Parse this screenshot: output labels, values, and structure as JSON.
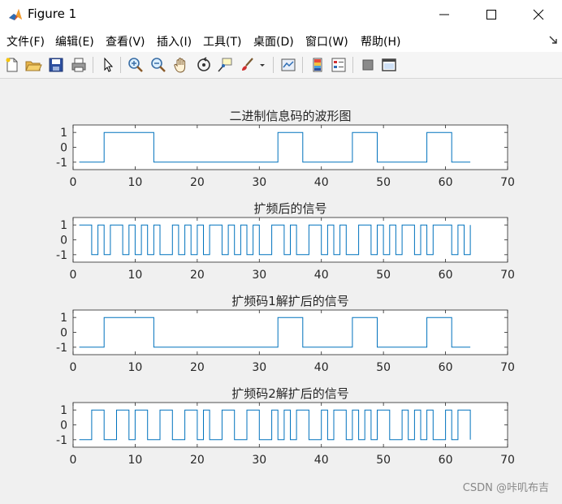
{
  "window": {
    "title": "Figure 1",
    "minimize_label": "–",
    "maximize_label": "□",
    "close_label": "✕"
  },
  "menu": [
    "文件(F)",
    "编辑(E)",
    "查看(V)",
    "插入(I)",
    "工具(T)",
    "桌面(D)",
    "窗口(W)",
    "帮助(H)"
  ],
  "toolbar": {
    "buttons": [
      "new-figure-icon",
      "open-file-icon",
      "save-icon",
      "print-icon",
      "edit-plot-cursor-icon",
      "zoom-in-icon",
      "zoom-out-icon",
      "pan-hand-icon",
      "rotate-3d-icon",
      "data-cursor-icon",
      "brush-icon",
      "brush-dropdown-icon",
      "link-plot-icon",
      "colorbar-icon",
      "legend-icon",
      "hide-plot-tools-icon",
      "show-plot-tools-icon"
    ]
  },
  "watermark": "CSDN @咔叽布吉",
  "chart_data": [
    {
      "type": "line",
      "title": "二进制信息码的波形图",
      "xlim": [
        0,
        70
      ],
      "ylim": [
        -1.5,
        1.5
      ],
      "xticks": [
        "0",
        "10",
        "20",
        "30",
        "40",
        "50",
        "60",
        "70"
      ],
      "yticks": [
        "1",
        "0",
        "-1"
      ],
      "step_x": [
        1,
        5,
        5,
        13,
        13,
        33,
        33,
        37,
        37,
        45,
        45,
        49,
        49,
        57,
        57,
        61,
        61,
        64
      ],
      "step_y": [
        -1,
        -1,
        1,
        1,
        -1,
        -1,
        1,
        1,
        -1,
        -1,
        1,
        1,
        -1,
        -1,
        1,
        1,
        -1,
        -1
      ],
      "color": "#0072bd"
    },
    {
      "type": "line",
      "title": "扩频后的信号",
      "xlim": [
        0,
        70
      ],
      "ylim": [
        -1.5,
        1.5
      ],
      "xticks": [
        "0",
        "10",
        "20",
        "30",
        "40",
        "50",
        "60",
        "70"
      ],
      "yticks": [
        "1",
        "0",
        "-1"
      ],
      "sample_x_start": 1,
      "sample_x_step": 1,
      "sample_values": [
        1,
        1,
        -1,
        1,
        -1,
        1,
        1,
        -1,
        1,
        -1,
        1,
        -1,
        1,
        -1,
        -1,
        1,
        -1,
        1,
        -1,
        1,
        -1,
        1,
        1,
        -1,
        1,
        -1,
        1,
        -1,
        1,
        -1,
        -1,
        1,
        1,
        -1,
        1,
        -1,
        -1,
        1,
        1,
        -1,
        1,
        -1,
        1,
        -1,
        -1,
        1,
        1,
        -1,
        1,
        -1,
        1,
        -1,
        1,
        1,
        -1,
        1,
        -1,
        1,
        1,
        1,
        -1,
        1,
        -1,
        1
      ],
      "color": "#0072bd"
    },
    {
      "type": "line",
      "title": "扩频码1解扩后的信号",
      "xlim": [
        0,
        70
      ],
      "ylim": [
        -1.5,
        1.5
      ],
      "xticks": [
        "0",
        "10",
        "20",
        "30",
        "40",
        "50",
        "60",
        "70"
      ],
      "yticks": [
        "1",
        "0",
        "-1"
      ],
      "step_x": [
        1,
        5,
        5,
        13,
        13,
        33,
        33,
        37,
        37,
        45,
        45,
        49,
        49,
        57,
        57,
        61,
        61,
        64
      ],
      "step_y": [
        -1,
        -1,
        1,
        1,
        -1,
        -1,
        1,
        1,
        -1,
        -1,
        1,
        1,
        -1,
        -1,
        1,
        1,
        -1,
        -1
      ],
      "color": "#0072bd"
    },
    {
      "type": "line",
      "title": "扩频码2解扩后的信号",
      "xlim": [
        0,
        70
      ],
      "ylim": [
        -1.5,
        1.5
      ],
      "xticks": [
        "0",
        "10",
        "20",
        "30",
        "40",
        "50",
        "60",
        "70"
      ],
      "yticks": [
        "1",
        "0",
        "-1"
      ],
      "sample_x_start": 1,
      "sample_x_step": 1,
      "sample_values": [
        -1,
        -1,
        1,
        1,
        -1,
        -1,
        1,
        1,
        -1,
        1,
        1,
        -1,
        -1,
        1,
        1,
        -1,
        -1,
        1,
        1,
        -1,
        1,
        -1,
        -1,
        1,
        1,
        -1,
        -1,
        1,
        1,
        -1,
        -1,
        1,
        -1,
        1,
        -1,
        1,
        1,
        -1,
        -1,
        1,
        -1,
        1,
        1,
        -1,
        1,
        -1,
        1,
        -1,
        1,
        1,
        -1,
        -1,
        1,
        -1,
        1,
        -1,
        1,
        -1,
        -1,
        1,
        -1,
        1,
        1,
        -1
      ],
      "color": "#0072bd"
    }
  ]
}
